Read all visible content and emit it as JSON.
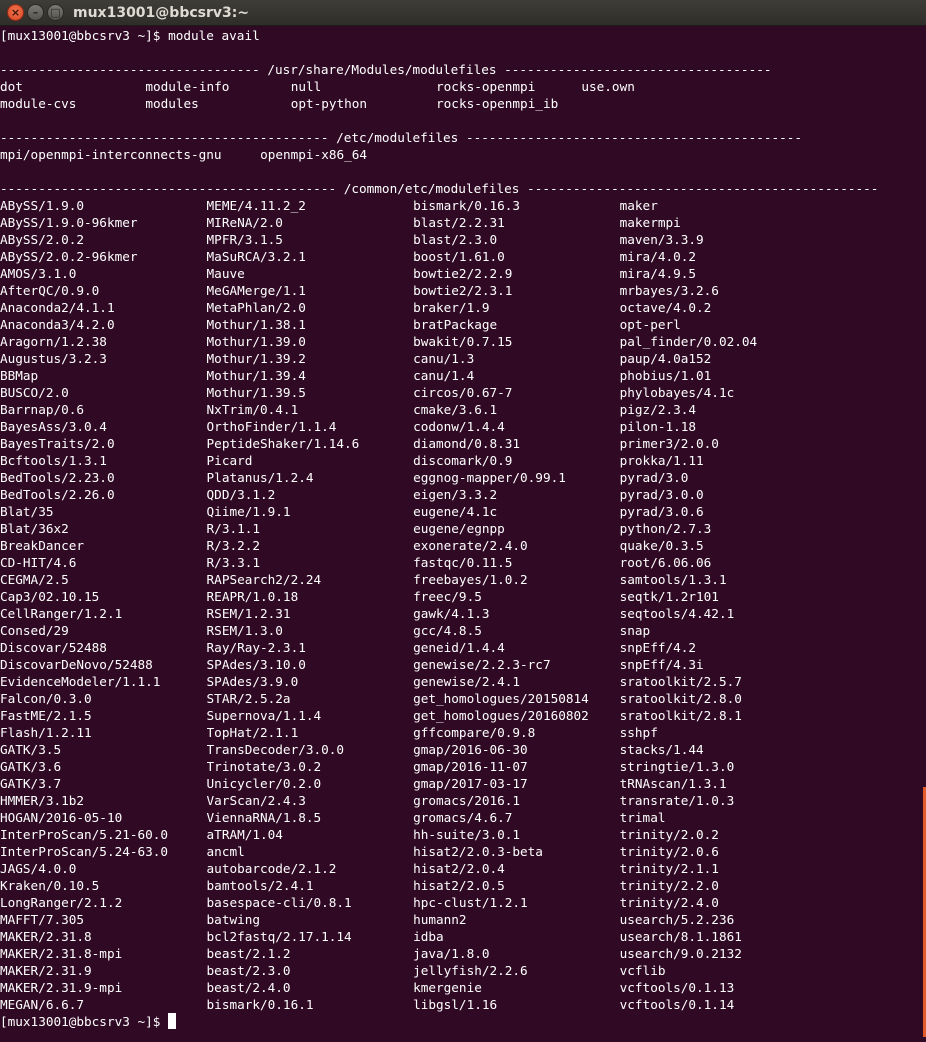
{
  "window": {
    "title": "mux13001@bbcsrv3:~",
    "close_glyph": "×",
    "min_glyph": "–",
    "max_glyph": "□"
  },
  "terminal": {
    "prompt": "[mux13001@bbcsrv3 ~]$ ",
    "command": "module avail",
    "sections": [
      {
        "header": "---------------------------------- /usr/share/Modules/modulefiles -----------------------------------",
        "col_widths": [
          19,
          19,
          19,
          19,
          19
        ],
        "rows": [
          [
            "dot",
            "module-info",
            "null",
            "rocks-openmpi",
            "use.own"
          ],
          [
            "module-cvs",
            "modules",
            "opt-python",
            "rocks-openmpi_ib",
            ""
          ]
        ]
      },
      {
        "header": "------------------------------------------- /etc/modulefiles --------------------------------------------",
        "col_widths": [
          34,
          30
        ],
        "rows": [
          [
            "mpi/openmpi-interconnects-gnu",
            "openmpi-x86_64"
          ]
        ]
      },
      {
        "header": "-------------------------------------------- /common/etc/modulefiles ----------------------------------------------",
        "col_widths": [
          27,
          27,
          27,
          27
        ],
        "rows": [
          [
            "ABySS/1.9.0",
            "MEME/4.11.2_2",
            "bismark/0.16.3",
            "maker"
          ],
          [
            "ABySS/1.9.0-96kmer",
            "MIReNA/2.0",
            "blast/2.2.31",
            "makermpi"
          ],
          [
            "ABySS/2.0.2",
            "MPFR/3.1.5",
            "blast/2.3.0",
            "maven/3.3.9"
          ],
          [
            "ABySS/2.0.2-96kmer",
            "MaSuRCA/3.2.1",
            "boost/1.61.0",
            "mira/4.0.2"
          ],
          [
            "AMOS/3.1.0",
            "Mauve",
            "bowtie2/2.2.9",
            "mira/4.9.5"
          ],
          [
            "AfterQC/0.9.0",
            "MeGAMerge/1.1",
            "bowtie2/2.3.1",
            "mrbayes/3.2.6"
          ],
          [
            "Anaconda2/4.1.1",
            "MetaPhlan/2.0",
            "braker/1.9",
            "octave/4.0.2"
          ],
          [
            "Anaconda3/4.2.0",
            "Mothur/1.38.1",
            "bratPackage",
            "opt-perl"
          ],
          [
            "Aragorn/1.2.38",
            "Mothur/1.39.0",
            "bwakit/0.7.15",
            "pal_finder/0.02.04"
          ],
          [
            "Augustus/3.2.3",
            "Mothur/1.39.2",
            "canu/1.3",
            "paup/4.0a152"
          ],
          [
            "BBMap",
            "Mothur/1.39.4",
            "canu/1.4",
            "phobius/1.01"
          ],
          [
            "BUSCO/2.0",
            "Mothur/1.39.5",
            "circos/0.67-7",
            "phylobayes/4.1c"
          ],
          [
            "Barrnap/0.6",
            "NxTrim/0.4.1",
            "cmake/3.6.1",
            "pigz/2.3.4"
          ],
          [
            "BayesAss/3.0.4",
            "OrthoFinder/1.1.4",
            "codonw/1.4.4",
            "pilon-1.18"
          ],
          [
            "BayesTraits/2.0",
            "PeptideShaker/1.14.6",
            "diamond/0.8.31",
            "primer3/2.0.0"
          ],
          [
            "Bcftools/1.3.1",
            "Picard",
            "discomark/0.9",
            "prokka/1.11"
          ],
          [
            "BedTools/2.23.0",
            "Platanus/1.2.4",
            "eggnog-mapper/0.99.1",
            "pyrad/3.0"
          ],
          [
            "BedTools/2.26.0",
            "QDD/3.1.2",
            "eigen/3.3.2",
            "pyrad/3.0.0"
          ],
          [
            "Blat/35",
            "Qiime/1.9.1",
            "eugene/4.1c",
            "pyrad/3.0.6"
          ],
          [
            "Blat/36x2",
            "R/3.1.1",
            "eugene/egnpp",
            "python/2.7.3"
          ],
          [
            "BreakDancer",
            "R/3.2.2",
            "exonerate/2.4.0",
            "quake/0.3.5"
          ],
          [
            "CD-HIT/4.6",
            "R/3.3.1",
            "fastqc/0.11.5",
            "root/6.06.06"
          ],
          [
            "CEGMA/2.5",
            "RAPSearch2/2.24",
            "freebayes/1.0.2",
            "samtools/1.3.1"
          ],
          [
            "Cap3/02.10.15",
            "REAPR/1.0.18",
            "freec/9.5",
            "seqtk/1.2r101"
          ],
          [
            "CellRanger/1.2.1",
            "RSEM/1.2.31",
            "gawk/4.1.3",
            "seqtools/4.42.1"
          ],
          [
            "Consed/29",
            "RSEM/1.3.0",
            "gcc/4.8.5",
            "snap"
          ],
          [
            "Discovar/52488",
            "Ray/Ray-2.3.1",
            "geneid/1.4.4",
            "snpEff/4.2"
          ],
          [
            "DiscovarDeNovo/52488",
            "SPAdes/3.10.0",
            "genewise/2.2.3-rc7",
            "snpEff/4.3i"
          ],
          [
            "EvidenceModeler/1.1.1",
            "SPAdes/3.9.0",
            "genewise/2.4.1",
            "sratoolkit/2.5.7"
          ],
          [
            "Falcon/0.3.0",
            "STAR/2.5.2a",
            "get_homologues/20150814",
            "sratoolkit/2.8.0"
          ],
          [
            "FastME/2.1.5",
            "Supernova/1.1.4",
            "get_homologues/20160802",
            "sratoolkit/2.8.1"
          ],
          [
            "Flash/1.2.11",
            "TopHat/2.1.1",
            "gffcompare/0.9.8",
            "sshpf"
          ],
          [
            "GATK/3.5",
            "TransDecoder/3.0.0",
            "gmap/2016-06-30",
            "stacks/1.44"
          ],
          [
            "GATK/3.6",
            "Trinotate/3.0.2",
            "gmap/2016-11-07",
            "stringtie/1.3.0"
          ],
          [
            "GATK/3.7",
            "Unicycler/0.2.0",
            "gmap/2017-03-17",
            "tRNAscan/1.3.1"
          ],
          [
            "HMMER/3.1b2",
            "VarScan/2.4.3",
            "gromacs/2016.1",
            "transrate/1.0.3"
          ],
          [
            "HOGAN/2016-05-10",
            "ViennaRNA/1.8.5",
            "gromacs/4.6.7",
            "trimal"
          ],
          [
            "InterProScan/5.21-60.0",
            "aTRAM/1.04",
            "hh-suite/3.0.1",
            "trinity/2.0.2"
          ],
          [
            "InterProScan/5.24-63.0",
            "ancml",
            "hisat2/2.0.3-beta",
            "trinity/2.0.6"
          ],
          [
            "JAGS/4.0.0",
            "autobarcode/2.1.2",
            "hisat2/2.0.4",
            "trinity/2.1.1"
          ],
          [
            "Kraken/0.10.5",
            "bamtools/2.4.1",
            "hisat2/2.0.5",
            "trinity/2.2.0"
          ],
          [
            "LongRanger/2.1.2",
            "basespace-cli/0.8.1",
            "hpc-clust/1.2.1",
            "trinity/2.4.0"
          ],
          [
            "MAFFT/7.305",
            "batwing",
            "humann2",
            "usearch/5.2.236"
          ],
          [
            "MAKER/2.31.8",
            "bcl2fastq/2.17.1.14",
            "idba",
            "usearch/8.1.1861"
          ],
          [
            "MAKER/2.31.8-mpi",
            "beast/2.1.2",
            "java/1.8.0",
            "usearch/9.0.2132"
          ],
          [
            "MAKER/2.31.9",
            "beast/2.3.0",
            "jellyfish/2.2.6",
            "vcflib"
          ],
          [
            "MAKER/2.31.9-mpi",
            "beast/2.4.0",
            "kmergenie",
            "vcftools/0.1.13"
          ],
          [
            "MEGAN/6.6.7",
            "bismark/0.16.1",
            "libgsl/1.16",
            "vcftools/0.1.14"
          ]
        ]
      }
    ],
    "final_prompt": "[mux13001@bbcsrv3 ~]$ "
  },
  "colors": {
    "background": "#300a24",
    "foreground": "#ffffff",
    "scrollbar": "#e45b2b"
  }
}
